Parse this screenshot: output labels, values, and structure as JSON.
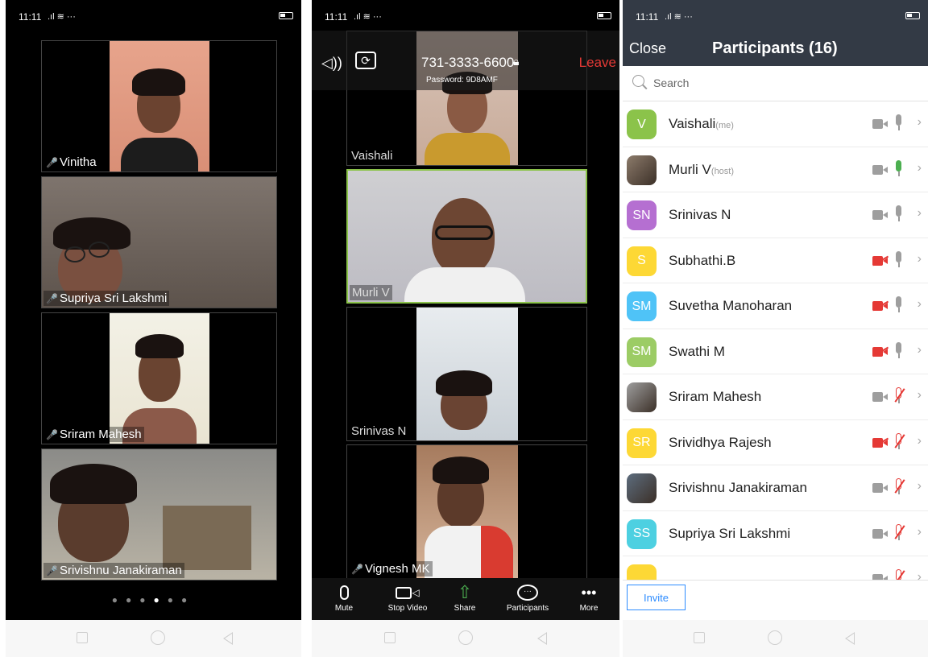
{
  "status": {
    "time": "11:11",
    "signal": "..ıl",
    "more": "···"
  },
  "screen1": {
    "tiles": [
      {
        "name": "Vinitha"
      },
      {
        "name": "Supriya Sri Lakshmi"
      },
      {
        "name": "Sriram Mahesh"
      },
      {
        "name": "Srivishnu Janakiraman"
      }
    ],
    "page_dots": {
      "count": 6,
      "active": 4
    }
  },
  "screen2": {
    "meeting_id": "731-3333-6600",
    "password": "Password: 9D8AMF",
    "leave_label": "Leave",
    "tiles": [
      {
        "name": "Vaishali"
      },
      {
        "name": "Murli V"
      },
      {
        "name": "Srinivas N"
      },
      {
        "name": "Vignesh MK"
      }
    ],
    "toolbar": {
      "mute": "Mute",
      "stop_video": "Stop Video",
      "share": "Share",
      "participants": "Participants",
      "more": "More"
    }
  },
  "screen3": {
    "close_label": "Close",
    "title": "Participants (16)",
    "search_placeholder": "Search",
    "invite_label": "Invite",
    "participants": [
      {
        "initials": "V",
        "name": "Vaishali",
        "tag": "(me)",
        "color": "#8bc34a",
        "video": "on",
        "audio": "on",
        "photo": false
      },
      {
        "initials": "",
        "name": "Murli V",
        "tag": "(host)",
        "color": "#8c7b6b",
        "video": "on",
        "audio": "speaking",
        "photo": true
      },
      {
        "initials": "SN",
        "name": "Srinivas N",
        "tag": "",
        "color": "#b56fd1",
        "video": "on",
        "audio": "on",
        "photo": false
      },
      {
        "initials": "S",
        "name": "Subhathi.B",
        "tag": "",
        "color": "#fdd835",
        "video": "off",
        "audio": "on",
        "photo": false
      },
      {
        "initials": "SM",
        "name": "Suvetha Manoharan",
        "tag": "",
        "color": "#4fc3f7",
        "video": "off",
        "audio": "on",
        "photo": false
      },
      {
        "initials": "SM",
        "name": "Swathi M",
        "tag": "",
        "color": "#9ccc65",
        "video": "off",
        "audio": "on",
        "photo": false
      },
      {
        "initials": "",
        "name": "Sriram Mahesh",
        "tag": "",
        "color": "#9e9e9e",
        "video": "on",
        "audio": "muted",
        "photo": true
      },
      {
        "initials": "SR",
        "name": "Srividhya Rajesh",
        "tag": "",
        "color": "#fdd835",
        "video": "off",
        "audio": "muted",
        "photo": false
      },
      {
        "initials": "",
        "name": "Srivishnu Janakiraman",
        "tag": "",
        "color": "#5d6d7e",
        "video": "on",
        "audio": "muted",
        "photo": true
      },
      {
        "initials": "SS",
        "name": "Supriya Sri Lakshmi",
        "tag": "",
        "color": "#4dd0e1",
        "video": "on",
        "audio": "muted",
        "photo": false
      },
      {
        "initials": "",
        "name": "",
        "tag": "",
        "color": "#fdd835",
        "video": "on",
        "audio": "muted",
        "photo": false
      }
    ],
    "colors": {
      "header_bg": "#333a45",
      "accent": "#2d8cff",
      "muted_red": "#e53935",
      "speaking_green": "#4caf50"
    }
  }
}
